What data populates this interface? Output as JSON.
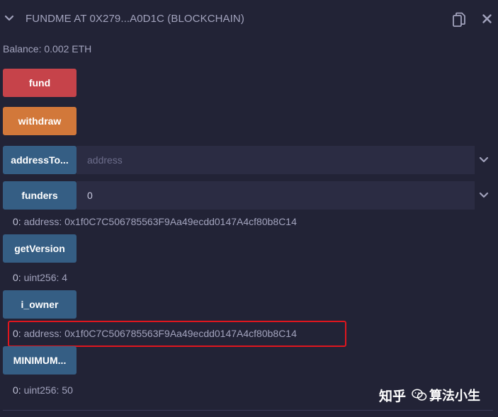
{
  "contract": {
    "title": "FUNDME AT 0X279...A0D1C (BLOCKCHAIN)",
    "balance": "Balance: 0.002 ETH"
  },
  "buttons": {
    "fund": "fund",
    "withdraw": "withdraw",
    "address_to": "addressTo...",
    "funders": "funders",
    "get_version": "getVersion",
    "i_owner": "i_owner",
    "minimum": "MINIMUM..."
  },
  "inputs": {
    "address_to_placeholder": "address",
    "funders_value": "0"
  },
  "results": {
    "funders": {
      "key": "0:",
      "value": " address: 0x1f0C7C506785563F9Aa49ecdd0147A4cf80b8C14"
    },
    "get_version": {
      "key": "0:",
      "value": " uint256: 4"
    },
    "i_owner": {
      "key": "0:",
      "value": " address: 0x1f0C7C506785563F9Aa49ecdd0147A4cf80b8C14"
    },
    "minimum": {
      "key": "0:",
      "value": " uint256: 50"
    }
  },
  "watermark": {
    "text1": "知乎",
    "text2": "算法小生"
  },
  "colors": {
    "background": "#222336",
    "fund_button": "#c6434a",
    "withdraw_button": "#d2783a",
    "call_button": "#355e84",
    "highlight_box": "#e0161e"
  },
  "icons": {
    "collapse": "chevron-down-icon",
    "copy": "copy-icon",
    "close": "close-icon",
    "expand": "chevron-down-icon"
  }
}
